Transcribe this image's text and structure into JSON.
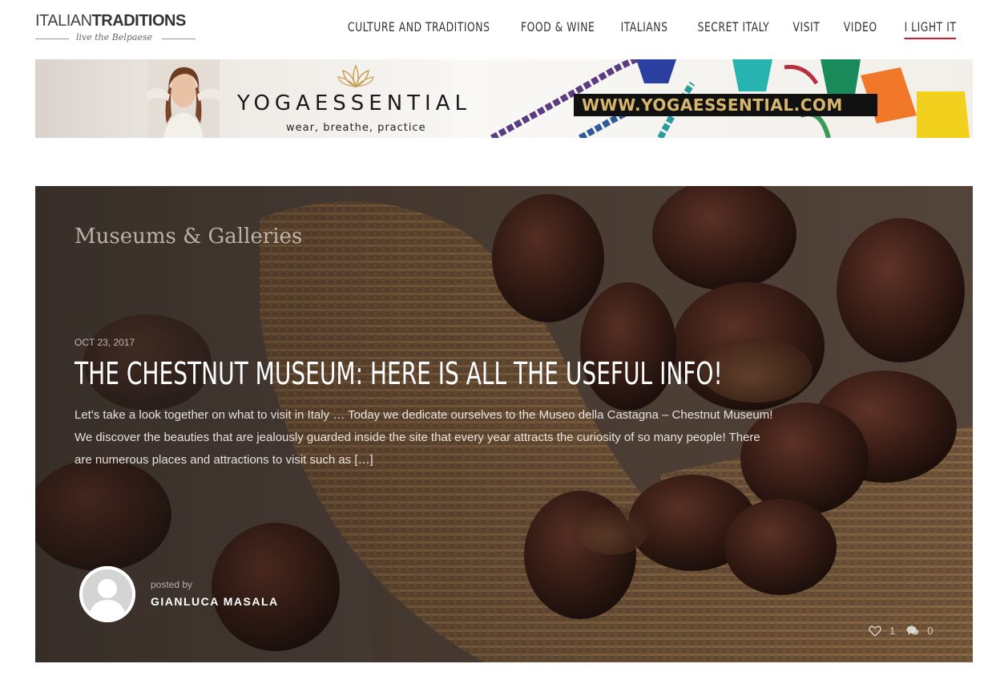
{
  "header": {
    "logo": {
      "part1": "ITALIAN",
      "part2": "TRADITIONS",
      "tagline": "live the Belpaese"
    },
    "nav": [
      {
        "label": "CULTURE AND TRADITIONS"
      },
      {
        "label": "FOOD & WINE"
      },
      {
        "label": "ITALIANS"
      },
      {
        "label": "SECRET ITALY"
      },
      {
        "label": "VISIT"
      },
      {
        "label": "VIDEO"
      },
      {
        "label": "I LIGHT IT",
        "active": true
      }
    ],
    "accent_color": "#c8202a"
  },
  "banner": {
    "brand": "YOGAESSENTIAL",
    "slogan": "wear, breathe, practice",
    "url": "WWW.YOGAESSENTIAL.COM",
    "url_color": "#d6b56c"
  },
  "article": {
    "category": "Museums & Galleries",
    "date": "OCT 23, 2017",
    "title": "THE CHESTNUT MUSEUM: HERE IS ALL THE USEFUL INFO!",
    "excerpt": "Let's take a look together on what to visit in Italy … Today we dedicate ourselves to the Museo della Castagna – Chestnut Museum! We discover the beauties that are jealously guarded inside the site that every year attracts the curiosity of so many people! There are numerous places and attractions to visit such as […]",
    "posted_by_label": "posted by",
    "author": "GIANLUCA MASALA",
    "likes": "1",
    "comments": "0",
    "icons": {
      "like": "heart-icon",
      "comments": "comment-bubbles-icon",
      "avatar": "user-avatar-icon"
    }
  }
}
